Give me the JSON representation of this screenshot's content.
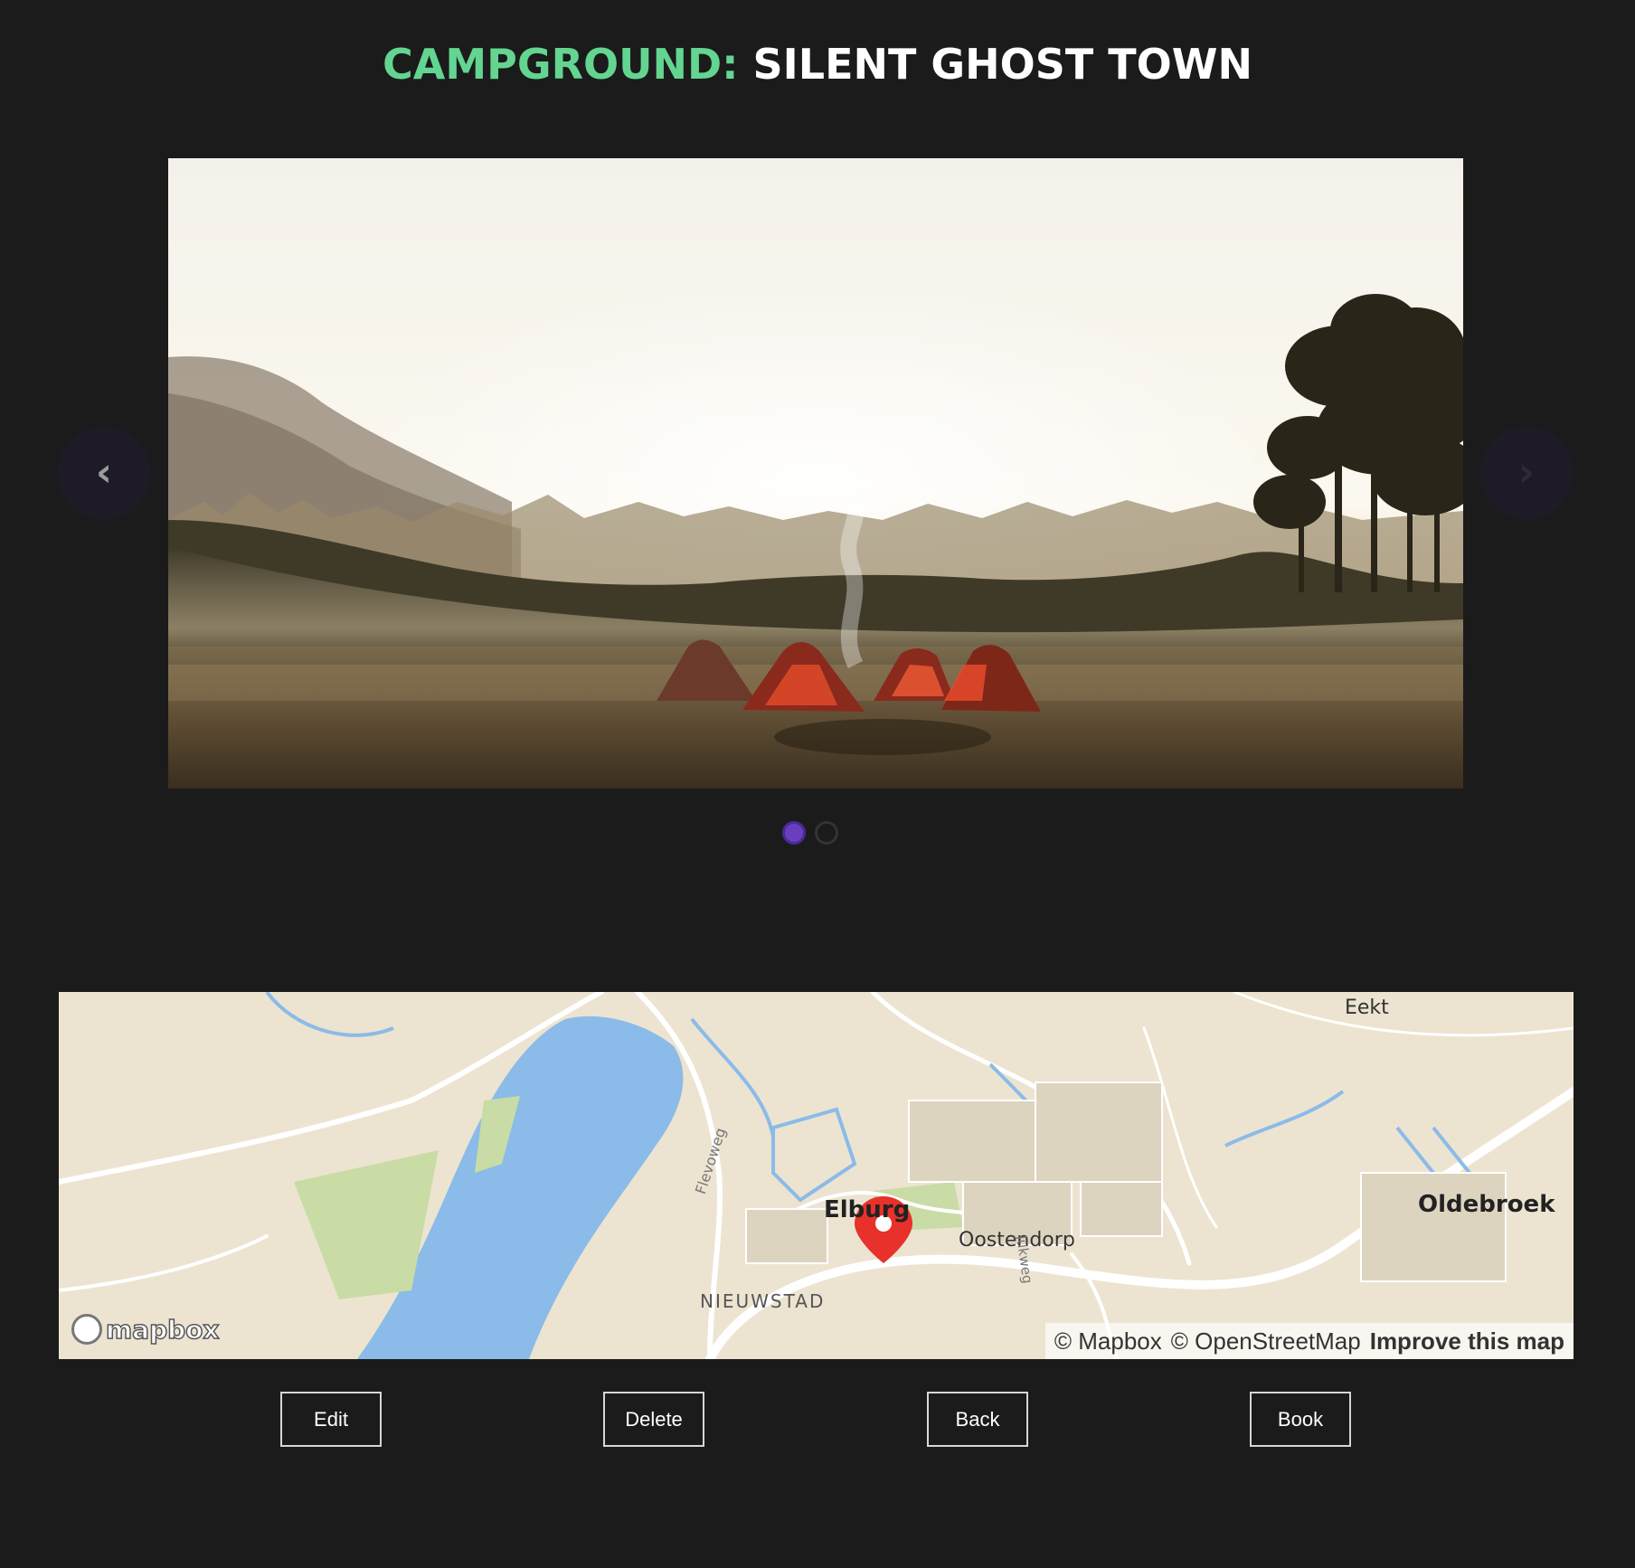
{
  "header": {
    "label": "CAMPGROUND:",
    "name": "SILENT GHOST TOWN"
  },
  "carousel": {
    "prev_icon": "‹",
    "next_icon": "›",
    "slide_count": 2,
    "active_slide": 1
  },
  "map": {
    "places": {
      "eekt": "Eekt",
      "elburg": "Elburg",
      "oostendorp": "Oostendorp",
      "nieuwstad": "NIEUWSTAD",
      "oldebroek": "Oldebroek",
      "flevoweg": "Flevoweg",
      "jukweg": "Jukweg"
    },
    "logo": "mapbox",
    "attribution": {
      "mapbox": "© Mapbox",
      "osm": "© OpenStreetMap",
      "improve": "Improve this map"
    },
    "marker_icon": "map-pin-icon"
  },
  "actions": {
    "edit": "Edit",
    "delete": "Delete",
    "back": "Back",
    "book": "Book"
  },
  "colors": {
    "background": "#1b1b1b",
    "accent": "#63d591",
    "dot_active": "#6a3fbf",
    "water": "#8bbbe8",
    "land": "#ece4d1",
    "marker": "#e8312a"
  }
}
